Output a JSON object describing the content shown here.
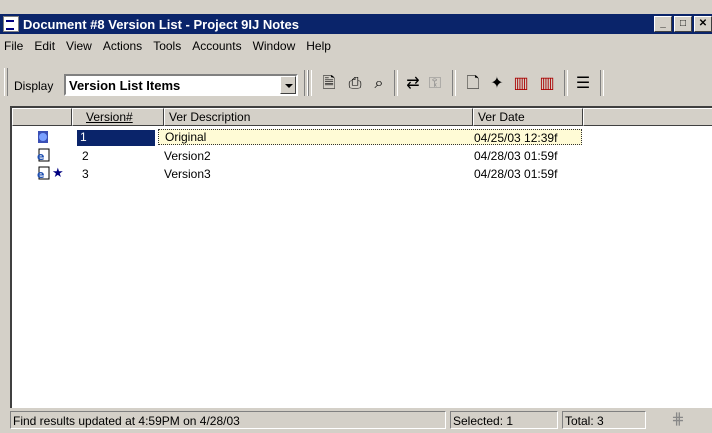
{
  "window": {
    "title": "Document #8 Version List - Project 9IJ Notes"
  },
  "menu": [
    "File",
    "Edit",
    "View",
    "Actions",
    "Tools",
    "Accounts",
    "Window",
    "Help"
  ],
  "toolbar": {
    "display_label": "Display",
    "display_value": "Version List Items"
  },
  "columns": [
    "Version#",
    "Ver Description",
    "Ver Date"
  ],
  "rows": [
    {
      "version": "1",
      "description": "Original",
      "date": "04/25/03 12:39f",
      "selected": true,
      "starred": false
    },
    {
      "version": "2",
      "description": "Version2",
      "date": "04/28/03 01:59f",
      "selected": false,
      "starred": false
    },
    {
      "version": "3",
      "description": "Version3",
      "date": "04/28/03 01:59f",
      "selected": false,
      "starred": true
    }
  ],
  "status": {
    "message": "Find results updated at 4:59PM on 4/28/03",
    "selected": "Selected: 1",
    "total": "Total: 3"
  }
}
